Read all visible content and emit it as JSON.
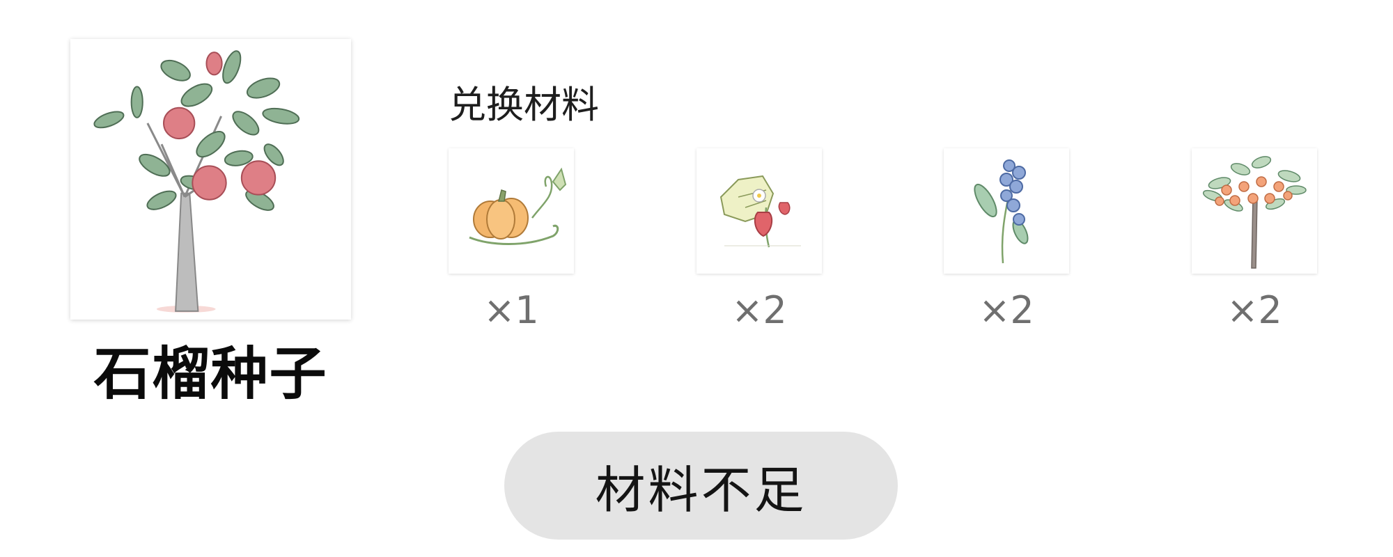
{
  "seed": {
    "name": "石榴种子",
    "image_icon": "pomegranate-tree-icon"
  },
  "materials": {
    "title": "兑换材料",
    "items": [
      {
        "icon": "pumpkin-icon",
        "quantity": "×1"
      },
      {
        "icon": "strawberry-icon",
        "quantity": "×2"
      },
      {
        "icon": "blueberry-icon",
        "quantity": "×2"
      },
      {
        "icon": "orange-tree-icon",
        "quantity": "×2"
      }
    ]
  },
  "action_button": {
    "label": "材料不足",
    "state": "disabled",
    "background": "#e4e4e4"
  }
}
